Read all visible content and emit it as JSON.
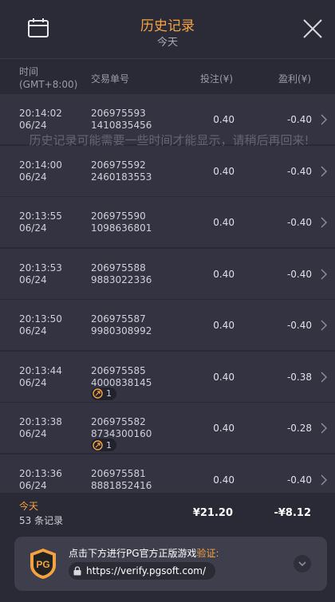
{
  "header": {
    "title": "历史记录",
    "subtitle": "今天",
    "calendar_icon": "calendar-icon",
    "close_icon": "close-icon"
  },
  "columns": {
    "time_line1": "时间",
    "time_line2": "(GMT+8:00)",
    "order": "交易单号",
    "bet": "投注(¥)",
    "profit": "盈利(¥)"
  },
  "overlay_message": "历史记录可能需要一些时间才能显示，请稍后再回来!",
  "rows": [
    {
      "time": "20:14:02",
      "date": "06/24",
      "order1": "206975593",
      "order2": "1410835456",
      "bet": "0.40",
      "profit": "-0.40",
      "badge": null
    },
    {
      "time": "20:14:00",
      "date": "06/24",
      "order1": "206975592",
      "order2": "2460183553",
      "bet": "0.40",
      "profit": "-0.40",
      "badge": null
    },
    {
      "time": "20:13:55",
      "date": "06/24",
      "order1": "206975590",
      "order2": "1098636801",
      "bet": "0.40",
      "profit": "-0.40",
      "badge": null
    },
    {
      "time": "20:13:53",
      "date": "06/24",
      "order1": "206975588",
      "order2": "9883022336",
      "bet": "0.40",
      "profit": "-0.40",
      "badge": null
    },
    {
      "time": "20:13:50",
      "date": "06/24",
      "order1": "206975587",
      "order2": "9980308992",
      "bet": "0.40",
      "profit": "-0.40",
      "badge": null
    },
    {
      "time": "20:13:44",
      "date": "06/24",
      "order1": "206975585",
      "order2": "4000838145",
      "bet": "0.40",
      "profit": "-0.38",
      "badge": "1"
    },
    {
      "time": "20:13:38",
      "date": "06/24",
      "order1": "206975582",
      "order2": "8734300160",
      "bet": "0.40",
      "profit": "-0.28",
      "badge": "1"
    },
    {
      "time": "20:13:36",
      "date": "06/24",
      "order1": "206975581",
      "order2": "8881852416",
      "bet": "0.40",
      "profit": "-0.40",
      "badge": null
    }
  ],
  "summary": {
    "today": "今天",
    "count": "53 条记录",
    "total_bet": "¥21.20",
    "total_profit": "-¥8.12"
  },
  "verify": {
    "text": "点击下方进行PG官方正版游戏",
    "highlight": "验证:",
    "url": "https://verify.pgsoft.com/",
    "logo": "PG"
  },
  "colors": {
    "accent": "#f5a341",
    "background": "#2a2a36",
    "row": "#333342"
  }
}
